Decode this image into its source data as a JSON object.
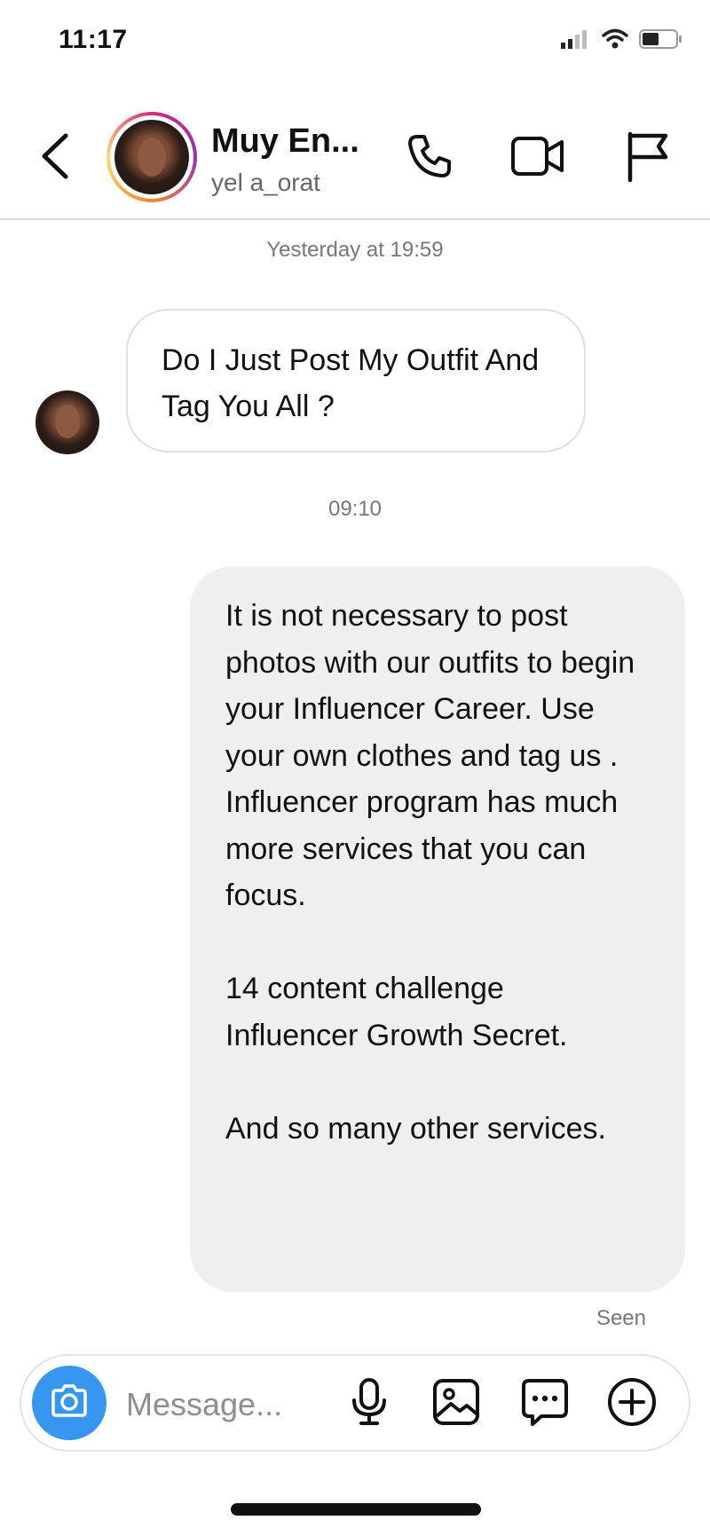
{
  "status_bar": {
    "time": "11:17"
  },
  "header": {
    "name": "Muy En...",
    "username": "yel a_orat"
  },
  "conversation": {
    "timestamp_1": "Yesterday at 19:59",
    "incoming_message": "Do I Just Post My Outfit And Tag You All ?",
    "timestamp_2": "09:10",
    "outgoing_message": {
      "paragraph_1": "It is not necessary to post photos with our outfits to begin your Influencer Career. Use your own clothes and tag us . Influencer program has much more services that you can focus.",
      "paragraph_2_line_1": "14 content challenge",
      "paragraph_2_line_2": "Influencer Growth Secret.",
      "paragraph_3": "And so many other services."
    },
    "seen_label": "Seen"
  },
  "composer": {
    "placeholder": "Message..."
  },
  "colors": {
    "camera_button": "#3797f0",
    "outgoing_bubble": "#efefef",
    "story_ring": [
      "#d62976",
      "#962fbf",
      "#f58529",
      "#feda77"
    ]
  },
  "icons": {
    "header": [
      "back-icon",
      "phone-icon",
      "video-camera-icon",
      "flag-icon"
    ],
    "composer": [
      "camera-icon",
      "microphone-icon",
      "gallery-icon",
      "sticker-icon",
      "plus-circle-icon"
    ],
    "status": [
      "signal-icon",
      "wifi-icon",
      "battery-icon"
    ]
  }
}
